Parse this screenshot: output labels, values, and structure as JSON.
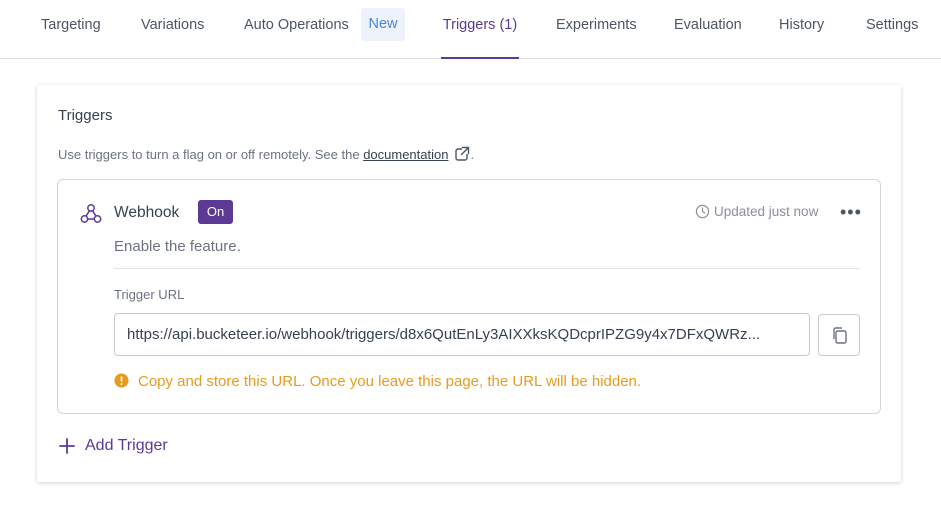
{
  "tabs": [
    {
      "label": "Targeting"
    },
    {
      "label": "Variations"
    },
    {
      "label": "Auto Operations"
    },
    {
      "label": "Triggers (1)"
    },
    {
      "label": "Experiments"
    },
    {
      "label": "Evaluation"
    },
    {
      "label": "History"
    },
    {
      "label": "Settings"
    }
  ],
  "new_badge": "New",
  "card": {
    "title": "Triggers",
    "description_prefix": "Use triggers to turn a flag on or off remotely. See the ",
    "doc_link": "documentation",
    "description_suffix": "."
  },
  "trigger": {
    "type": "Webhook",
    "status": "On",
    "updated": "Updated just now",
    "more": "•••",
    "description": "Enable the feature.",
    "url_label": "Trigger URL",
    "url_value": "https://api.bucketeer.io/webhook/triggers/d8x6QutEnLy3AIXXksKQDcprIPZG9y4x7DFxQWRz...",
    "warning": "Copy and store this URL. Once you leave this page, the URL will be hidden."
  },
  "add_trigger": "Add Trigger",
  "colors": {
    "accent": "#5b3a96",
    "warning": "#e69b1e",
    "new_badge_bg": "#eef2fb",
    "new_badge_text": "#4a86d6"
  },
  "icons": [
    "webhook-icon",
    "clock-icon",
    "external-link-icon",
    "copy-icon",
    "warning-icon",
    "plus-icon",
    "more-icon"
  ]
}
